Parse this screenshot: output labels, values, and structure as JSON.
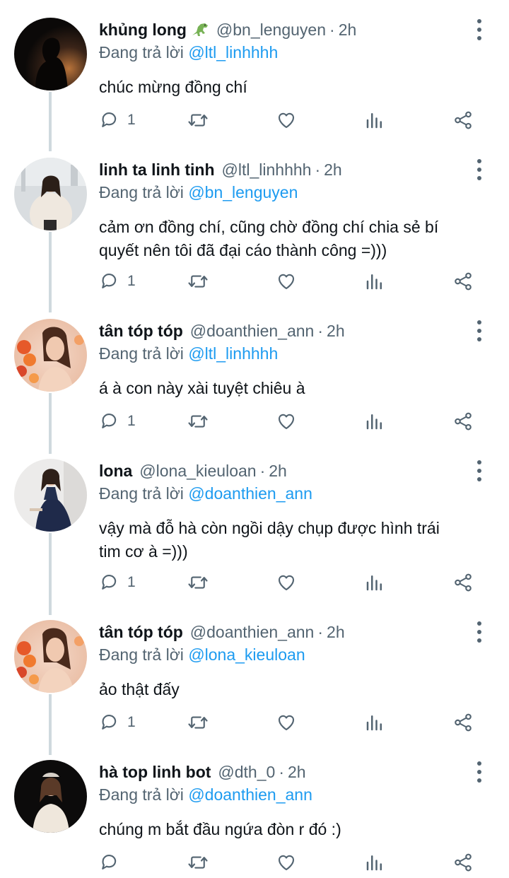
{
  "tweets": [
    {
      "name": "khủng long",
      "emoji": "dinosaur-emoji",
      "handle": "@bn_lenguyen",
      "time": "2h",
      "reply_prefix": "Đang trả lời",
      "reply_to": "@ltl_linhhhh",
      "text": "chúc mừng đồng chí",
      "reply_count": "1",
      "avatar": "dark-silhouette-avatar"
    },
    {
      "name": "linh ta linh tinh",
      "emoji": "",
      "handle": "@ltl_linhhhh",
      "time": "2h",
      "reply_prefix": "Đang trả lời",
      "reply_to": "@bn_lenguyen",
      "text": "cảm ơn đồng chí, cũng chờ đồng chí chia sẻ bí\nquyết nên tôi đã đại cáo thành công =)))",
      "reply_count": "1",
      "avatar": "woman-white-sweater-avatar"
    },
    {
      "name": "tân tóp tóp",
      "emoji": "",
      "handle": "@doanthien_ann",
      "time": "2h",
      "reply_prefix": "Đang trả lời",
      "reply_to": "@ltl_linhhhh",
      "text": "á à con này xài tuyệt chiêu à",
      "reply_count": "1",
      "avatar": "woman-flowers-avatar"
    },
    {
      "name": "lona",
      "emoji": "",
      "handle": "@lona_kieuloan",
      "time": "2h",
      "reply_prefix": "Đang trả lời",
      "reply_to": "@doanthien_ann",
      "text": "vậy mà đỗ hà còn ngồi dậy chụp được hình trái\ntim cơ à =)))",
      "reply_count": "1",
      "avatar": "woman-black-dress-avatar"
    },
    {
      "name": "tân tóp tóp",
      "emoji": "",
      "handle": "@doanthien_ann",
      "time": "2h",
      "reply_prefix": "Đang trả lời",
      "reply_to": "@lona_kieuloan",
      "text": "ảo thật đấy",
      "reply_count": "1",
      "avatar": "woman-flowers-avatar"
    },
    {
      "name": "hà top linh bot",
      "emoji": "",
      "handle": "@dth_0",
      "time": "2h",
      "reply_prefix": "Đang trả lời",
      "reply_to": "@doanthien_ann",
      "text": "chúng m bắt đầu ngứa đòn r đó :)",
      "reply_count": "",
      "avatar": "woman-white-jacket-avatar"
    }
  ],
  "icons": {
    "reply": "reply-icon",
    "retweet": "retweet-icon",
    "like": "heart-icon",
    "views": "views-icon",
    "share": "share-icon",
    "more": "more-vertical-icon"
  },
  "colors": {
    "text": "#0f1419",
    "secondary": "#536471",
    "mention": "#1d9bf0",
    "thread_line": "#cfd9de"
  }
}
